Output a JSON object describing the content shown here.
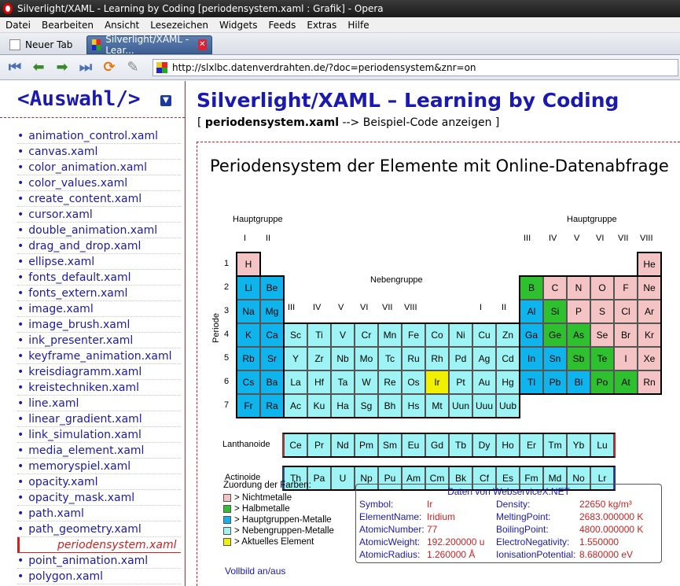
{
  "window": {
    "title": "Silverlight/XAML - Learning by Coding [periodensystem.xaml : Grafik] - Opera"
  },
  "menu": [
    "Datei",
    "Bearbeiten",
    "Ansicht",
    "Lesezeichen",
    "Widgets",
    "Feeds",
    "Extras",
    "Hilfe"
  ],
  "tabs": {
    "new_tab": "Neuer Tab",
    "active": "Silverlight/XAML - Lear..."
  },
  "address": "http://slxlbc.datenverdrahten.de/?doc=periodensystem&znr=on",
  "sidebar": {
    "title": "<Auswahl/>",
    "items": [
      "animation_control.xaml",
      "canvas.xaml",
      "color_animation.xaml",
      "color_values.xaml",
      "create_content.xaml",
      "cursor.xaml",
      "double_animation.xaml",
      "drag_and_drop.xaml",
      "ellipse.xaml",
      "fonts_default.xaml",
      "fonts_extern.xaml",
      "image.xaml",
      "image_brush.xaml",
      "ink_presenter.xaml",
      "keyframe_animation.xaml",
      "kreisdiagramm.xaml",
      "kreistechniken.xaml",
      "line.xaml",
      "linear_gradient.xaml",
      "link_simulation.xaml",
      "media_element.xaml",
      "memoryspiel.xaml",
      "opacity.xaml",
      "opacity_mask.xaml",
      "path.xaml",
      "path_geometry.xaml",
      "periodensystem.xaml",
      "point_animation.xaml",
      "polygon.xaml"
    ],
    "active": "periodensystem.xaml"
  },
  "main": {
    "title": "Silverlight/XAML – Learning by Coding",
    "crumb_open": "[",
    "crumb_file": "periodensystem.xaml",
    "crumb_rest": "--> Beispiel-Code anzeigen ]",
    "heading": "Periodensystem der Elemente mit Online-Datenabfrage"
  },
  "colors": {
    "nichtmetalle": "#f4c4c4",
    "halbmetalle": "#2ec02e",
    "hauptgruppen_metalle": "#10b4ec",
    "nebengruppen_metalle": "#9ef4f4",
    "aktuell": "#f0f000"
  },
  "ptable": {
    "hauptgruppe_label": "Hauptgruppe",
    "nebengruppe_label": "Nebengruppe",
    "periode_label": "Periode",
    "left_groups": [
      "I",
      "II"
    ],
    "right_groups": [
      "III",
      "IV",
      "V",
      "VI",
      "VII",
      "VIII"
    ],
    "sub_groups": [
      "III",
      "IV",
      "V",
      "VI",
      "VII",
      "VIII",
      "I",
      "II"
    ],
    "periods": [
      "1",
      "2",
      "3",
      "4",
      "5",
      "6",
      "7"
    ],
    "lanthanoide_label": "Lanthanoide",
    "actinoide_label": "Actinoide",
    "elements": [
      {
        "s": "H",
        "p": 1,
        "g": 1,
        "c": "nichtmetalle"
      },
      {
        "s": "He",
        "p": 1,
        "g": 18,
        "c": "nichtmetalle"
      },
      {
        "s": "Li",
        "p": 2,
        "g": 1,
        "c": "hauptgruppen_metalle"
      },
      {
        "s": "Be",
        "p": 2,
        "g": 2,
        "c": "hauptgruppen_metalle"
      },
      {
        "s": "B",
        "p": 2,
        "g": 13,
        "c": "halbmetalle"
      },
      {
        "s": "C",
        "p": 2,
        "g": 14,
        "c": "nichtmetalle"
      },
      {
        "s": "N",
        "p": 2,
        "g": 15,
        "c": "nichtmetalle"
      },
      {
        "s": "O",
        "p": 2,
        "g": 16,
        "c": "nichtmetalle"
      },
      {
        "s": "F",
        "p": 2,
        "g": 17,
        "c": "nichtmetalle"
      },
      {
        "s": "Ne",
        "p": 2,
        "g": 18,
        "c": "nichtmetalle"
      },
      {
        "s": "Na",
        "p": 3,
        "g": 1,
        "c": "hauptgruppen_metalle"
      },
      {
        "s": "Mg",
        "p": 3,
        "g": 2,
        "c": "hauptgruppen_metalle"
      },
      {
        "s": "Al",
        "p": 3,
        "g": 13,
        "c": "hauptgruppen_metalle"
      },
      {
        "s": "Si",
        "p": 3,
        "g": 14,
        "c": "halbmetalle"
      },
      {
        "s": "P",
        "p": 3,
        "g": 15,
        "c": "nichtmetalle"
      },
      {
        "s": "S",
        "p": 3,
        "g": 16,
        "c": "nichtmetalle"
      },
      {
        "s": "Cl",
        "p": 3,
        "g": 17,
        "c": "nichtmetalle"
      },
      {
        "s": "Ar",
        "p": 3,
        "g": 18,
        "c": "nichtmetalle"
      },
      {
        "s": "K",
        "p": 4,
        "g": 1,
        "c": "hauptgruppen_metalle"
      },
      {
        "s": "Ca",
        "p": 4,
        "g": 2,
        "c": "hauptgruppen_metalle"
      },
      {
        "s": "Sc",
        "p": 4,
        "g": 3,
        "c": "nebengruppen_metalle"
      },
      {
        "s": "Ti",
        "p": 4,
        "g": 4,
        "c": "nebengruppen_metalle"
      },
      {
        "s": "V",
        "p": 4,
        "g": 5,
        "c": "nebengruppen_metalle"
      },
      {
        "s": "Cr",
        "p": 4,
        "g": 6,
        "c": "nebengruppen_metalle"
      },
      {
        "s": "Mn",
        "p": 4,
        "g": 7,
        "c": "nebengruppen_metalle"
      },
      {
        "s": "Fe",
        "p": 4,
        "g": 8,
        "c": "nebengruppen_metalle"
      },
      {
        "s": "Co",
        "p": 4,
        "g": 9,
        "c": "nebengruppen_metalle"
      },
      {
        "s": "Ni",
        "p": 4,
        "g": 10,
        "c": "nebengruppen_metalle"
      },
      {
        "s": "Cu",
        "p": 4,
        "g": 11,
        "c": "nebengruppen_metalle"
      },
      {
        "s": "Zn",
        "p": 4,
        "g": 12,
        "c": "nebengruppen_metalle"
      },
      {
        "s": "Ga",
        "p": 4,
        "g": 13,
        "c": "hauptgruppen_metalle"
      },
      {
        "s": "Ge",
        "p": 4,
        "g": 14,
        "c": "halbmetalle"
      },
      {
        "s": "As",
        "p": 4,
        "g": 15,
        "c": "halbmetalle"
      },
      {
        "s": "Se",
        "p": 4,
        "g": 16,
        "c": "nichtmetalle"
      },
      {
        "s": "Br",
        "p": 4,
        "g": 17,
        "c": "nichtmetalle"
      },
      {
        "s": "Kr",
        "p": 4,
        "g": 18,
        "c": "nichtmetalle"
      },
      {
        "s": "Rb",
        "p": 5,
        "g": 1,
        "c": "hauptgruppen_metalle"
      },
      {
        "s": "Sr",
        "p": 5,
        "g": 2,
        "c": "hauptgruppen_metalle"
      },
      {
        "s": "Y",
        "p": 5,
        "g": 3,
        "c": "nebengruppen_metalle"
      },
      {
        "s": "Zr",
        "p": 5,
        "g": 4,
        "c": "nebengruppen_metalle"
      },
      {
        "s": "Nb",
        "p": 5,
        "g": 5,
        "c": "nebengruppen_metalle"
      },
      {
        "s": "Mo",
        "p": 5,
        "g": 6,
        "c": "nebengruppen_metalle"
      },
      {
        "s": "Tc",
        "p": 5,
        "g": 7,
        "c": "nebengruppen_metalle"
      },
      {
        "s": "Ru",
        "p": 5,
        "g": 8,
        "c": "nebengruppen_metalle"
      },
      {
        "s": "Rh",
        "p": 5,
        "g": 9,
        "c": "nebengruppen_metalle"
      },
      {
        "s": "Pd",
        "p": 5,
        "g": 10,
        "c": "nebengruppen_metalle"
      },
      {
        "s": "Ag",
        "p": 5,
        "g": 11,
        "c": "nebengruppen_metalle"
      },
      {
        "s": "Cd",
        "p": 5,
        "g": 12,
        "c": "nebengruppen_metalle"
      },
      {
        "s": "In",
        "p": 5,
        "g": 13,
        "c": "hauptgruppen_metalle"
      },
      {
        "s": "Sn",
        "p": 5,
        "g": 14,
        "c": "hauptgruppen_metalle"
      },
      {
        "s": "Sb",
        "p": 5,
        "g": 15,
        "c": "halbmetalle"
      },
      {
        "s": "Te",
        "p": 5,
        "g": 16,
        "c": "halbmetalle"
      },
      {
        "s": "I",
        "p": 5,
        "g": 17,
        "c": "nichtmetalle"
      },
      {
        "s": "Xe",
        "p": 5,
        "g": 18,
        "c": "nichtmetalle"
      },
      {
        "s": "Cs",
        "p": 6,
        "g": 1,
        "c": "hauptgruppen_metalle"
      },
      {
        "s": "Ba",
        "p": 6,
        "g": 2,
        "c": "hauptgruppen_metalle"
      },
      {
        "s": "La",
        "p": 6,
        "g": 3,
        "c": "nebengruppen_metalle"
      },
      {
        "s": "Hf",
        "p": 6,
        "g": 4,
        "c": "nebengruppen_metalle"
      },
      {
        "s": "Ta",
        "p": 6,
        "g": 5,
        "c": "nebengruppen_metalle"
      },
      {
        "s": "W",
        "p": 6,
        "g": 6,
        "c": "nebengruppen_metalle"
      },
      {
        "s": "Re",
        "p": 6,
        "g": 7,
        "c": "nebengruppen_metalle"
      },
      {
        "s": "Os",
        "p": 6,
        "g": 8,
        "c": "nebengruppen_metalle"
      },
      {
        "s": "Ir",
        "p": 6,
        "g": 9,
        "c": "aktuell"
      },
      {
        "s": "Pt",
        "p": 6,
        "g": 10,
        "c": "nebengruppen_metalle"
      },
      {
        "s": "Au",
        "p": 6,
        "g": 11,
        "c": "nebengruppen_metalle"
      },
      {
        "s": "Hg",
        "p": 6,
        "g": 12,
        "c": "nebengruppen_metalle"
      },
      {
        "s": "Tl",
        "p": 6,
        "g": 13,
        "c": "hauptgruppen_metalle"
      },
      {
        "s": "Pb",
        "p": 6,
        "g": 14,
        "c": "hauptgruppen_metalle"
      },
      {
        "s": "Bi",
        "p": 6,
        "g": 15,
        "c": "hauptgruppen_metalle"
      },
      {
        "s": "Po",
        "p": 6,
        "g": 16,
        "c": "halbmetalle"
      },
      {
        "s": "At",
        "p": 6,
        "g": 17,
        "c": "halbmetalle"
      },
      {
        "s": "Rn",
        "p": 6,
        "g": 18,
        "c": "nichtmetalle"
      },
      {
        "s": "Fr",
        "p": 7,
        "g": 1,
        "c": "hauptgruppen_metalle"
      },
      {
        "s": "Ra",
        "p": 7,
        "g": 2,
        "c": "hauptgruppen_metalle"
      },
      {
        "s": "Ac",
        "p": 7,
        "g": 3,
        "c": "nebengruppen_metalle"
      },
      {
        "s": "Ku",
        "p": 7,
        "g": 4,
        "c": "nebengruppen_metalle"
      },
      {
        "s": "Ha",
        "p": 7,
        "g": 5,
        "c": "nebengruppen_metalle"
      },
      {
        "s": "Sg",
        "p": 7,
        "g": 6,
        "c": "nebengruppen_metalle"
      },
      {
        "s": "Bh",
        "p": 7,
        "g": 7,
        "c": "nebengruppen_metalle"
      },
      {
        "s": "Hs",
        "p": 7,
        "g": 8,
        "c": "nebengruppen_metalle"
      },
      {
        "s": "Mt",
        "p": 7,
        "g": 9,
        "c": "nebengruppen_metalle"
      },
      {
        "s": "Uun",
        "p": 7,
        "g": 10,
        "c": "nebengruppen_metalle"
      },
      {
        "s": "Uuu",
        "p": 7,
        "g": 11,
        "c": "nebengruppen_metalle"
      },
      {
        "s": "Uub",
        "p": 7,
        "g": 12,
        "c": "nebengruppen_metalle"
      }
    ],
    "lanthanoide": [
      "Ce",
      "Pr",
      "Nd",
      "Pm",
      "Sm",
      "Eu",
      "Gd",
      "Tb",
      "Dy",
      "Ho",
      "Er",
      "Tm",
      "Yb",
      "Lu"
    ],
    "actinoide": [
      "Th",
      "Pa",
      "U",
      "Np",
      "Pu",
      "Am",
      "Cm",
      "Bk",
      "Cf",
      "Es",
      "Fm",
      "Md",
      "No",
      "Lr"
    ]
  },
  "legend": {
    "title": "Zuordung der Farben:",
    "items": [
      {
        "key": "nichtmetalle",
        "label": "> Nichtmetalle"
      },
      {
        "key": "halbmetalle",
        "label": "> Halbmetalle"
      },
      {
        "key": "hauptgruppen_metalle",
        "label": "> Hauptgruppen-Metalle"
      },
      {
        "key": "nebengruppen_metalle",
        "label": "> Nebengruppen-Metalle"
      },
      {
        "key": "aktuell",
        "label": "> Aktuelles Element"
      }
    ],
    "vollbild": "Vollbild an/aus"
  },
  "info": {
    "header": "Daten von WebserviceX.NET",
    "left": [
      {
        "k": "Symbol:",
        "v": "Ir"
      },
      {
        "k": "ElementName:",
        "v": "Iridium"
      },
      {
        "k": "AtomicNumber:",
        "v": "77"
      },
      {
        "k": "AtomicWeight:",
        "v": "192.200000 u"
      },
      {
        "k": "AtomicRadius:",
        "v": "1.260000 Å"
      }
    ],
    "right": [
      {
        "k": "Density:",
        "v": "22650 kg/m³"
      },
      {
        "k": "MeltingPoint:",
        "v": "2683.000000 K"
      },
      {
        "k": "BoilingPoint:",
        "v": "4800.000000 K"
      },
      {
        "k": "ElectroNegativity:",
        "v": "1.550000"
      },
      {
        "k": "IonisationPotential:",
        "v": "8.680000 eV"
      }
    ]
  }
}
